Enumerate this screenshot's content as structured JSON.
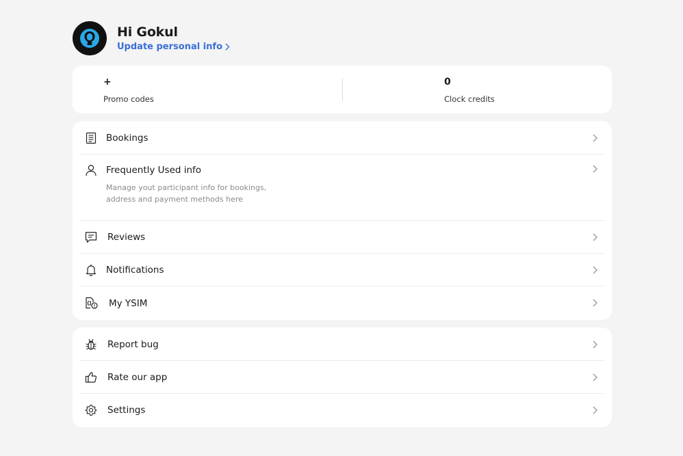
{
  "header": {
    "greeting": "Hi Gokul",
    "update_link": "Update personal info",
    "accent_color": "#3b6fd6",
    "avatar_icon": "user-avatar-icon",
    "avatar_color": "#29a8e8"
  },
  "stats": {
    "left": {
      "value": "+",
      "label": "Promo codes"
    },
    "right": {
      "value": "0",
      "label": "Clock credits"
    }
  },
  "menu_primary": [
    {
      "label": "Bookings",
      "icon": "document-icon"
    },
    {
      "label": "Frequently Used info",
      "icon": "person-icon",
      "description": "Manage yout participant info for bookings, address and payment methods here"
    },
    {
      "label": "Reviews",
      "icon": "chat-icon"
    },
    {
      "label": "Notifications",
      "icon": "bell-icon"
    },
    {
      "label": "My YSIM",
      "icon": "sim-card-icon"
    }
  ],
  "menu_secondary": [
    {
      "label": "Report bug",
      "icon": "bug-icon"
    },
    {
      "label": "Rate our app",
      "icon": "thumbs-up-icon"
    },
    {
      "label": "Settings",
      "icon": "gear-icon"
    }
  ]
}
